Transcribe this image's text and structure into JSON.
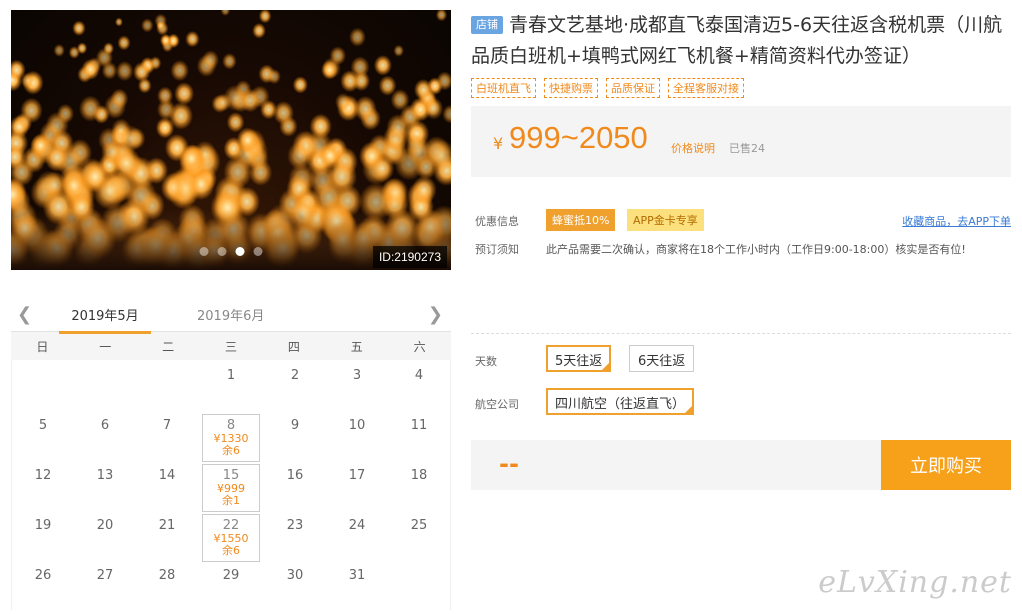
{
  "hero": {
    "id_label": "ID:2190273",
    "slide_count": 4,
    "active_slide": 2
  },
  "calendar": {
    "months": [
      "2019年5月",
      "2019年6月"
    ],
    "active_month": 0,
    "weekdays": [
      "日",
      "一",
      "二",
      "三",
      "四",
      "五",
      "六"
    ],
    "leading_blanks": 3,
    "days_in_month": 31,
    "available": {
      "8": {
        "price": "¥1330",
        "stock": "余6"
      },
      "15": {
        "price": "¥999",
        "stock": "余1"
      },
      "22": {
        "price": "¥1550",
        "stock": "余6"
      }
    }
  },
  "product": {
    "shop_badge": "店铺",
    "title": "青春文艺基地·成都直飞泰国清迈5-6天往返含税机票（川航品质白班机+填鸭式网红飞机餐+精简资料代办签证）",
    "tags": [
      "白班机直飞",
      "快捷购票",
      "品质保证",
      "全程客服对接"
    ],
    "price_symbol": "¥",
    "price_range": "999~2050",
    "price_note": "价格说明",
    "sold": "已售24"
  },
  "promo": {
    "label": "优惠信息",
    "badge1": "蜂蜜抵10%",
    "badge2": "APP金卡专享",
    "fav_link": "收藏商品，去APP下单"
  },
  "notice": {
    "label": "预订须知",
    "text": "此产品需要二次确认，商家将在18个工作小时内（工作日9:00-18:00）核实是否有位!"
  },
  "options": {
    "days_label": "天数",
    "days": [
      "5天往返",
      "6天往返"
    ],
    "days_selected": 0,
    "airline_label": "航空公司",
    "airlines": [
      "四川航空（往返直飞）"
    ],
    "airline_selected": 0
  },
  "buy": {
    "total": "--",
    "button": "立即购买"
  },
  "watermark": "eLvXing.net",
  "colors": {
    "accent": "#f0a12d",
    "price": "#f08a1c",
    "link": "#3a7bd5",
    "shop_badge": "#6aa5e2"
  }
}
